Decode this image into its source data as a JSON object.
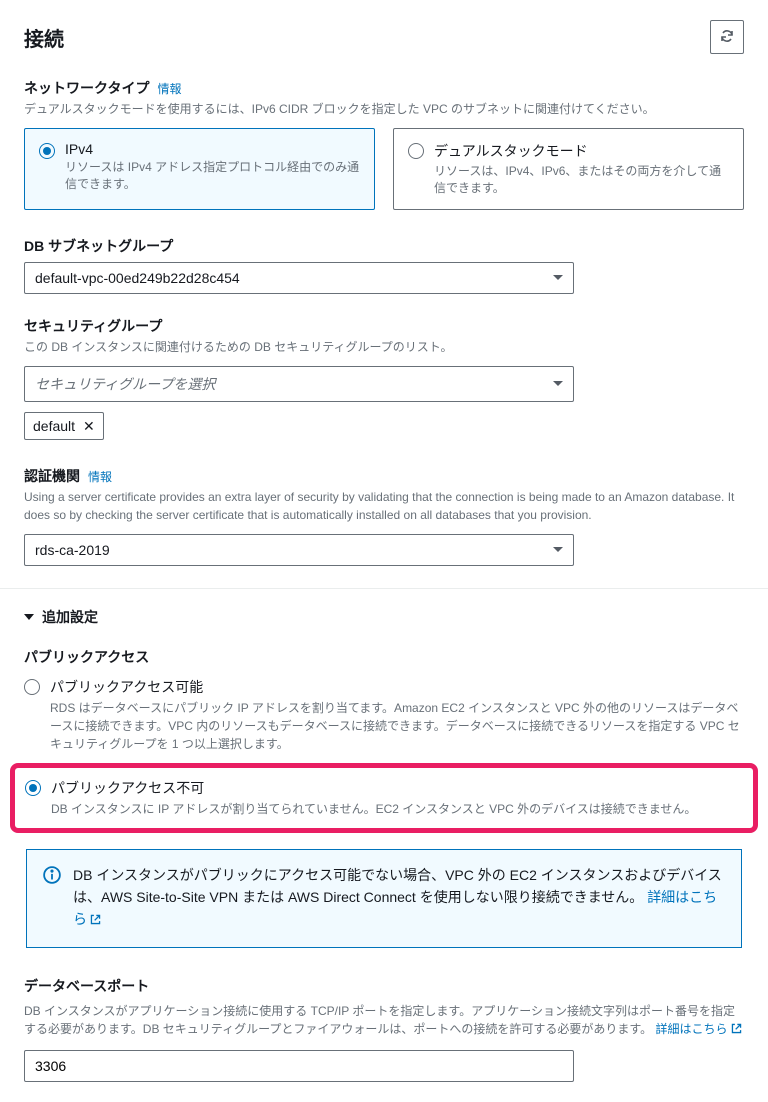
{
  "header": {
    "title": "接続"
  },
  "networkType": {
    "label": "ネットワークタイプ",
    "info": "情報",
    "help": "デュアルスタックモードを使用するには、IPv6 CIDR ブロックを指定した VPC のサブネットに関連付けてください。",
    "options": [
      {
        "title": "IPv4",
        "desc": "リソースは IPv4 アドレス指定プロトコル経由でのみ通信できます。",
        "selected": true
      },
      {
        "title": "デュアルスタックモード",
        "desc": "リソースは、IPv4、IPv6、またはその両方を介して通信できます。",
        "selected": false
      }
    ]
  },
  "subnetGroup": {
    "label": "DB サブネットグループ",
    "value": "default-vpc-00ed249b22d28c454"
  },
  "securityGroup": {
    "label": "セキュリティグループ",
    "help": "この DB インスタンスに関連付けるための DB セキュリティグループのリスト。",
    "placeholder": "セキュリティグループを選択",
    "chips": [
      "default"
    ]
  },
  "ca": {
    "label": "認証機関",
    "info": "情報",
    "help": "Using a server certificate provides an extra layer of security by validating that the connection is being made to an Amazon database. It does so by checking the server certificate that is automatically installed on all databases that you provision.",
    "value": "rds-ca-2019"
  },
  "additional": {
    "title": "追加設定",
    "publicAccess": {
      "label": "パブリックアクセス",
      "options": [
        {
          "title": "パブリックアクセス可能",
          "desc": "RDS はデータベースにパブリック IP アドレスを割り当てます。Amazon EC2 インスタンスと VPC 外の他のリソースはデータベースに接続できます。VPC 内のリソースもデータベースに接続できます。データベースに接続できるリソースを指定する VPC セキュリティグループを 1 つ以上選択します。",
          "selected": false
        },
        {
          "title": "パブリックアクセス不可",
          "desc": "DB インスタンスに IP アドレスが割り当てられていません。EC2 インスタンスと VPC 外のデバイスは接続できません。",
          "selected": true
        }
      ],
      "alert": {
        "text": "DB インスタンスがパブリックにアクセス可能でない場合、VPC 外の EC2 インスタンスおよびデバイスは、AWS Site-to-Site VPN または AWS Direct Connect を使用しない限り接続できません。",
        "link": "詳細はこちら"
      }
    },
    "port": {
      "label": "データベースポート",
      "helpPrefix": "DB インスタンスがアプリケーション接続に使用する TCP/IP ポートを指定します。アプリケーション接続文字列はポート番号を指定する必要があります。DB セキュリティグループとファイアウォールは、ポートへの接続を許可する必要があります。",
      "helpLink": "詳細はこちら",
      "value": "3306"
    }
  }
}
